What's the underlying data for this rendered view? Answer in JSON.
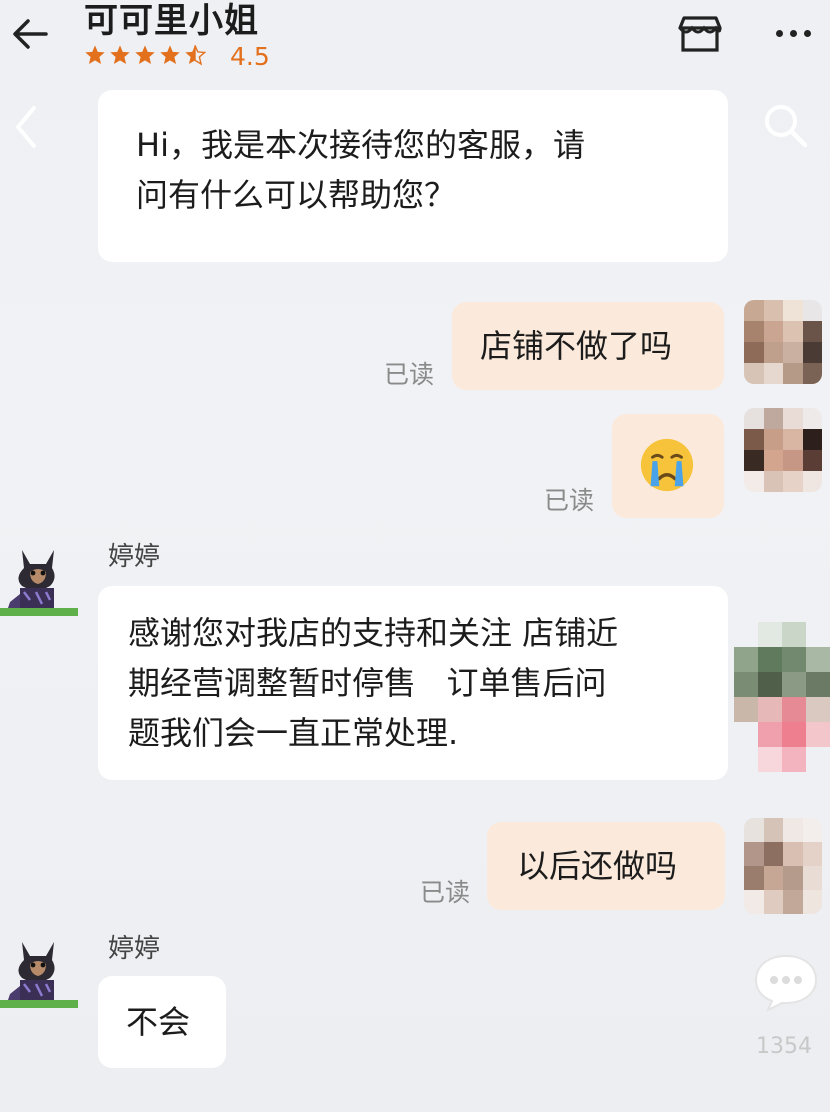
{
  "header": {
    "title": "可可里小姐",
    "rating": "4.5",
    "star_rating": 4.5
  },
  "messages": [
    {
      "side": "left",
      "text_line1": "Hi，我是本次接待您的客服，请",
      "text_line2": "问有什么可以帮助您？"
    },
    {
      "side": "right",
      "text": "店铺不做了吗",
      "status": "已读"
    },
    {
      "side": "right",
      "emoji": "crying-face",
      "status": "已读"
    },
    {
      "side": "left",
      "sender": "婷婷",
      "text_line1": "感谢您对我店的支持和关注 店铺近",
      "text_line2": "期经营调整暂时停售   订单售后问",
      "text_line3": "题我们会一直正常处理."
    },
    {
      "side": "right",
      "text": "以后还做吗",
      "status": "已读"
    },
    {
      "side": "left",
      "sender": "婷婷",
      "text": "不会"
    }
  ],
  "floating": {
    "count": "1354"
  },
  "colors": {
    "accent": "#e2701c",
    "user_bubble": "#fbeadc",
    "agent_bubble": "#ffffff"
  }
}
